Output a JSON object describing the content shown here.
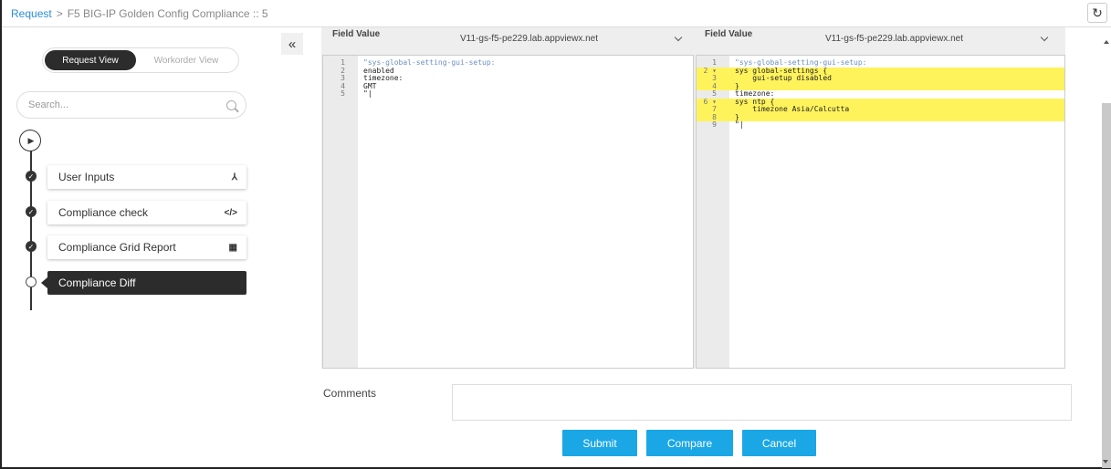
{
  "breadcrumb": {
    "link": "Request",
    "separator": ">",
    "title": "F5 BIG-IP Golden Config Compliance :: 5"
  },
  "view_toggle": {
    "active": "Request View",
    "inactive": "Workorder View"
  },
  "search": {
    "placeholder": "Search..."
  },
  "steps": [
    {
      "label": "User Inputs",
      "icon": "user-icon",
      "glyph": "⅄",
      "status": "done"
    },
    {
      "label": "Compliance check",
      "icon": "code-icon",
      "glyph": "</>",
      "status": "done"
    },
    {
      "label": "Compliance Grid Report",
      "icon": "grid-icon",
      "glyph": "▦",
      "status": "done"
    },
    {
      "label": "Compliance Diff",
      "icon": "",
      "glyph": "",
      "status": "active"
    }
  ],
  "collapse_glyph": "«",
  "left_editor": {
    "label": "Field Value",
    "selected": "V11-gs-f5-pe229.lab.appviewx.net",
    "lines": [
      {
        "n": "1",
        "text": "\"sys-global-setting-gui-setup:",
        "str": true
      },
      {
        "n": "2",
        "text": "enabled"
      },
      {
        "n": "3",
        "text": "timezone:"
      },
      {
        "n": "4",
        "text": "GMT"
      },
      {
        "n": "5",
        "text": "\"|",
        "cur": true
      }
    ]
  },
  "right_editor": {
    "label": "Field Value",
    "selected": "V11-gs-f5-pe229.lab.appviewx.net",
    "lines": [
      {
        "n": "1",
        "text": "\"sys-global-setting-gui-setup:",
        "str": true
      },
      {
        "n": "2 ▾",
        "text": "sys global-settings {",
        "hl": true
      },
      {
        "n": "3",
        "text": "    gui-setup disabled",
        "hl": true
      },
      {
        "n": "4",
        "text": "}",
        "hl": true
      },
      {
        "n": "5",
        "text": "timezone:"
      },
      {
        "n": "6 ▾",
        "text": "sys ntp {",
        "hl": true
      },
      {
        "n": "7",
        "text": "    timezone Asia/Calcutta",
        "hl": true
      },
      {
        "n": "8",
        "text": "}",
        "hl": true
      },
      {
        "n": "9",
        "text": "\"|",
        "cur": true
      }
    ]
  },
  "comments": {
    "label": "Comments",
    "value": ""
  },
  "buttons": {
    "submit": "Submit",
    "compare": "Compare",
    "cancel": "Cancel"
  },
  "colors": {
    "accent": "#1ba7e6",
    "link": "#2b8ed8",
    "diff_highlight": "#fff35c",
    "dark": "#2c2c2c"
  }
}
